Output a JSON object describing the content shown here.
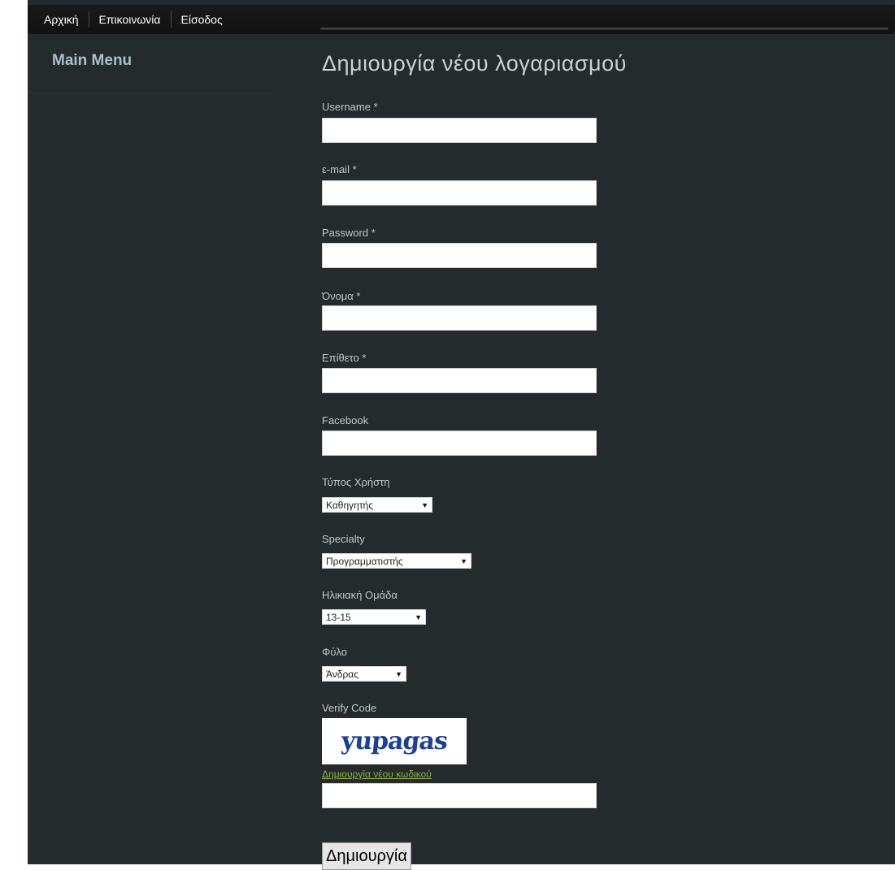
{
  "nav": {
    "items": [
      {
        "label": "Αρχική"
      },
      {
        "label": "Επικοινωνία"
      },
      {
        "label": "Είσοδος"
      }
    ]
  },
  "sidebar": {
    "title": "Main Menu"
  },
  "form": {
    "title": "Δημιουργία νέου λογαριασμού",
    "username_label": "Username *",
    "username_value": "",
    "email_label": "ε-mail *",
    "email_value": "",
    "password_label": "Password *",
    "password_value": "",
    "first_name_label": "Όνομα *",
    "first_name_value": "",
    "last_name_label": "Επίθετο *",
    "last_name_value": "",
    "facebook_label": "Facebook",
    "facebook_value": "",
    "user_type_label": "Τύπος Χρήστη",
    "user_type_value": "Καθηγητής",
    "specialty_label": "Specialty",
    "specialty_value": "Προγραμματιστής",
    "age_group_label": "Ηλικιακή Ομάδα",
    "age_group_value": "13-15",
    "gender_label": "Φύλο",
    "gender_value": "Άνδρας",
    "verify_code_label": "Verify Code",
    "captcha_text": "yupagas",
    "new_code_link": "Δημιουργία νέου κωδικού",
    "verify_code_value": "",
    "submit_label": "Δημιουργία"
  },
  "colors": {
    "page_background": "#232b2c",
    "nav_background": "#151515",
    "title": "#c9d2d3",
    "sidebar_title": "#a9c0c4",
    "link": "#8fb33e",
    "captcha": "#1a3f9a"
  }
}
